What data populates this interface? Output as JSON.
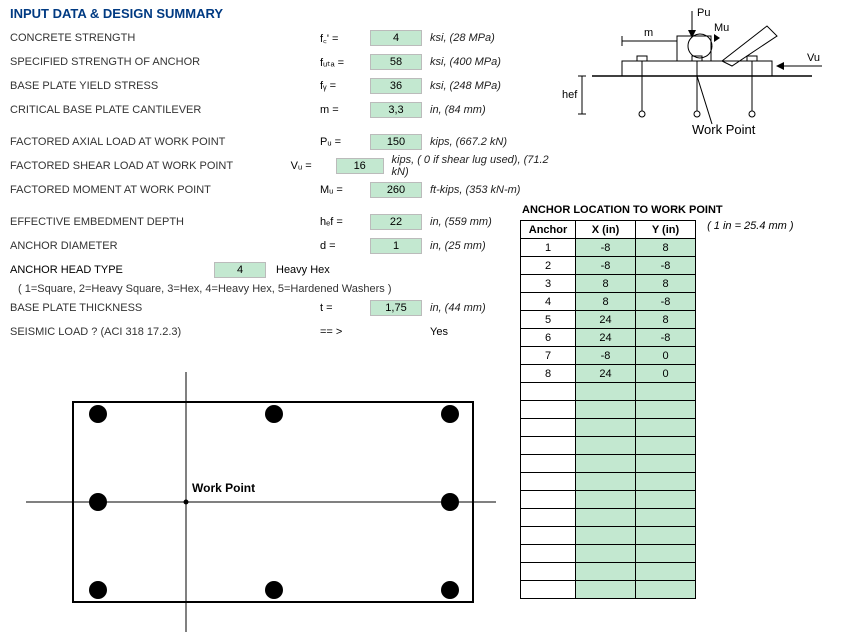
{
  "title": "INPUT DATA & DESIGN SUMMARY",
  "params": {
    "concrete_strength": {
      "label": "CONCRETE STRENGTH",
      "sym": "f꜀' =",
      "val": "4",
      "unit": "ksi, (28 MPa)"
    },
    "anchor_strength": {
      "label": "SPECIFIED STRENGTH OF ANCHOR",
      "sym": "fᵤₜₐ =",
      "val": "58",
      "unit": "ksi, (400 MPa)"
    },
    "yield_stress": {
      "label": "BASE PLATE YIELD STRESS",
      "sym": "fᵧ =",
      "val": "36",
      "unit": "ksi, (248 MPa)"
    },
    "cantilever": {
      "label": "CRITICAL BASE PLATE CANTILEVER",
      "sym": "m =",
      "val": "3,3",
      "unit": "in, (84 mm)"
    },
    "axial_load": {
      "label": "FACTORED AXIAL LOAD AT WORK POINT",
      "sym": "Pᵤ =",
      "val": "150",
      "unit": "kips, (667.2 kN)"
    },
    "shear_load": {
      "label": "FACTORED SHEAR LOAD AT WORK POINT",
      "sym": "Vᵤ =",
      "val": "16",
      "unit": "kips, ( 0 if shear lug used), (71.2 kN)"
    },
    "moment": {
      "label": "FACTORED MOMENT AT WORK POINT",
      "sym": "Mᵤ =",
      "val": "260",
      "unit": "ft-kips, (353 kN-m)"
    },
    "embedment": {
      "label": "EFFECTIVE EMBEDMENT DEPTH",
      "sym": "hₑf =",
      "val": "22",
      "unit": "in, (559 mm)"
    },
    "diameter": {
      "label": "ANCHOR DIAMETER",
      "sym": "d =",
      "val": "1",
      "unit": "in, (25 mm)"
    },
    "head_type": {
      "label": "ANCHOR HEAD TYPE",
      "val": "4",
      "desc": "Heavy Hex"
    },
    "head_note": "( 1=Square, 2=Heavy Square, 3=Hex, 4=Heavy Hex, 5=Hardened Washers )",
    "thickness": {
      "label": "BASE PLATE THICKNESS",
      "sym": "t =",
      "val": "1,75",
      "unit": "in, (44 mm)"
    },
    "seismic": {
      "label": "SEISMIC LOAD ? (ACI 318 17.2.3)",
      "sym": "== >",
      "val": "Yes"
    }
  },
  "anchor_table": {
    "title": "ANCHOR LOCATION TO WORK POINT",
    "headers": {
      "a": "Anchor",
      "x": "X (in)",
      "y": "Y (in)"
    },
    "scale_note": "( 1 in = 25.4 mm )",
    "rows": [
      {
        "n": "1",
        "x": "-8",
        "y": "8"
      },
      {
        "n": "2",
        "x": "-8",
        "y": "-8"
      },
      {
        "n": "3",
        "x": "8",
        "y": "8"
      },
      {
        "n": "4",
        "x": "8",
        "y": "-8"
      },
      {
        "n": "5",
        "x": "24",
        "y": "8"
      },
      {
        "n": "6",
        "x": "24",
        "y": "-8"
      },
      {
        "n": "7",
        "x": "-8",
        "y": "0"
      },
      {
        "n": "8",
        "x": "24",
        "y": "0"
      }
    ],
    "empty_rows": 12
  },
  "diagram_labels": {
    "pu": "Pu",
    "m": "m",
    "mu": "Mu",
    "vu": "Vu",
    "hef": "hef",
    "wp": "Work Point"
  },
  "plan": {
    "wp_label": "Work Point"
  }
}
